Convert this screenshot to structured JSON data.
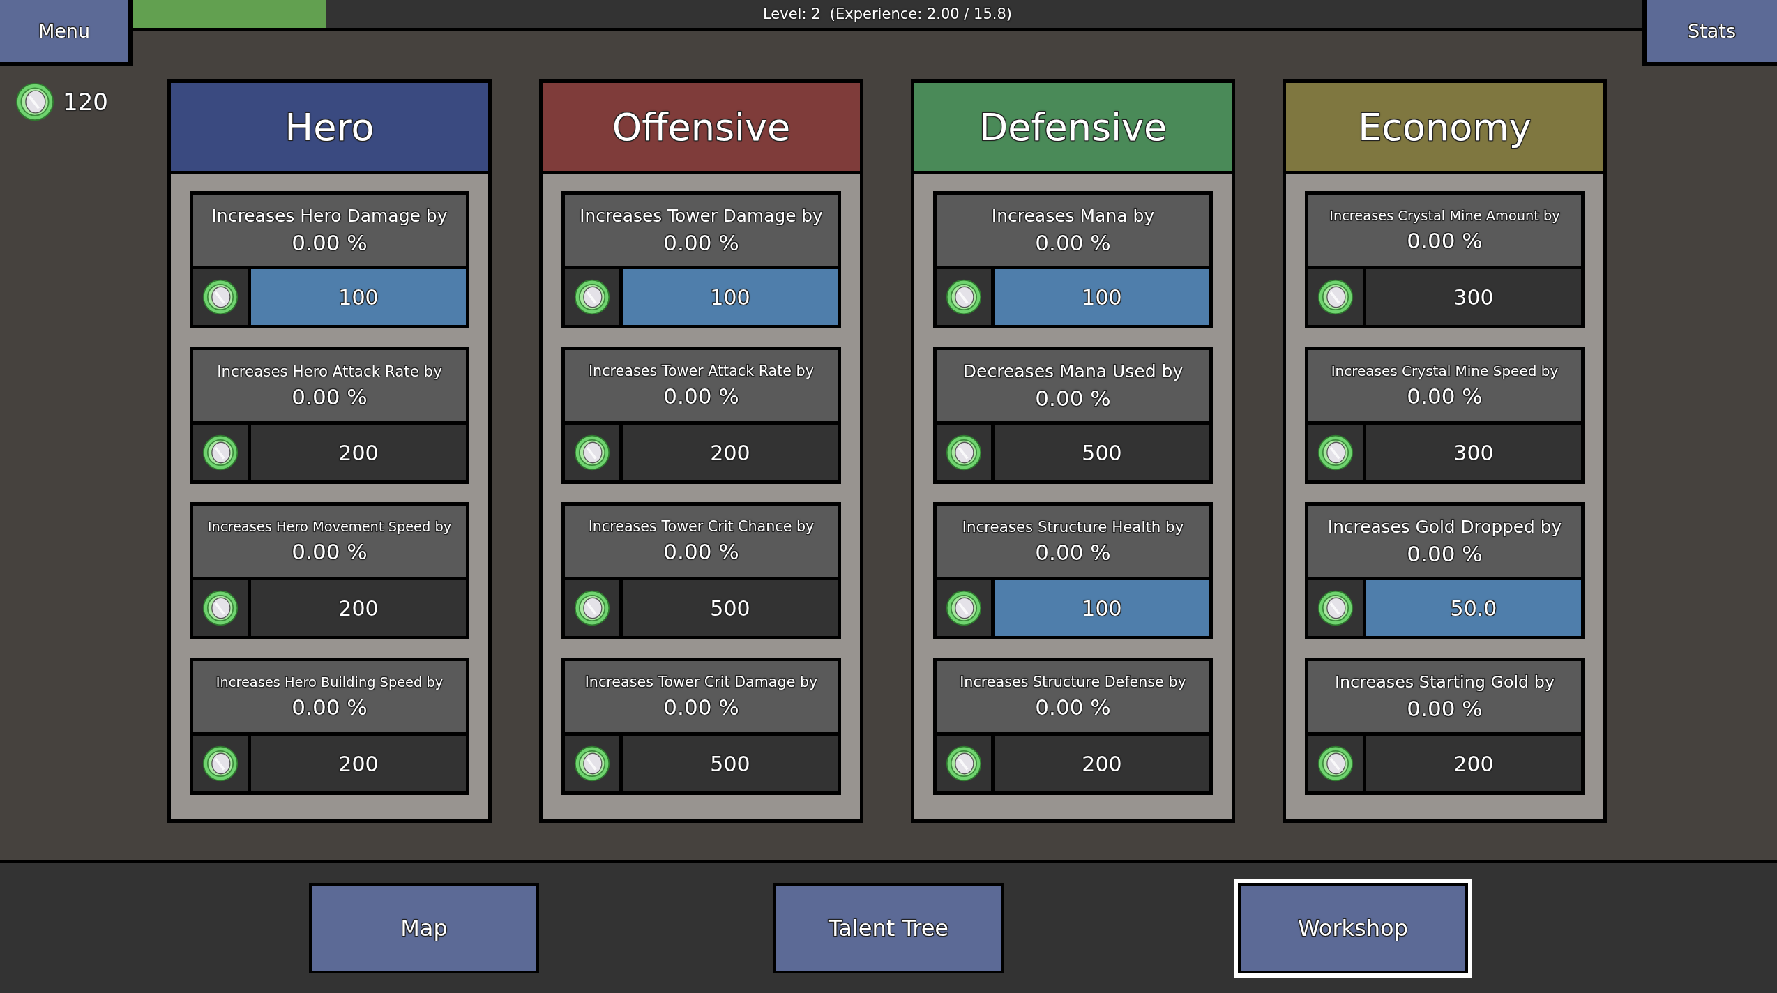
{
  "menu_button": "Menu",
  "experience_bar": {
    "label": "Level: 2  (Experience: 2.00 / 15.8)",
    "level": 0.128
  },
  "stats_button": "Stats",
  "currency": "120",
  "columns": [
    {
      "title": "Hero",
      "color": "#3a4a80",
      "upgrades": [
        {
          "label": "Increases Hero Damage by",
          "value": "0.00 %",
          "cost": "100",
          "affordable": true
        },
        {
          "label": "Increases Hero Attack Rate by",
          "value": "0.00 %",
          "cost": "200",
          "affordable": false
        },
        {
          "label": "Increases Hero Movement Speed by",
          "value": "0.00 %",
          "cost": "200",
          "affordable": false
        },
        {
          "label": "Increases Hero Building Speed by",
          "value": "0.00 %",
          "cost": "200",
          "affordable": false
        }
      ]
    },
    {
      "title": "Offensive",
      "color": "#7f3c3a",
      "upgrades": [
        {
          "label": "Increases Tower Damage by",
          "value": "0.00 %",
          "cost": "100",
          "affordable": true
        },
        {
          "label": "Increases Tower Attack Rate by",
          "value": "0.00 %",
          "cost": "200",
          "affordable": false
        },
        {
          "label": "Increases Tower Crit Chance by",
          "value": "0.00 %",
          "cost": "500",
          "affordable": false
        },
        {
          "label": "Increases Tower Crit Damage by",
          "value": "0.00 %",
          "cost": "500",
          "affordable": false
        }
      ]
    },
    {
      "title": "Defensive",
      "color": "#4a8a58",
      "upgrades": [
        {
          "label": "Increases Mana by",
          "value": "0.00 %",
          "cost": "100",
          "affordable": true
        },
        {
          "label": "Decreases Mana Used by",
          "value": "0.00 %",
          "cost": "500",
          "affordable": false
        },
        {
          "label": "Increases Structure Health by",
          "value": "0.00 %",
          "cost": "100",
          "affordable": true
        },
        {
          "label": "Increases Structure Defense by",
          "value": "0.00 %",
          "cost": "200",
          "affordable": false
        }
      ]
    },
    {
      "title": "Economy",
      "color": "#7f7740",
      "upgrades": [
        {
          "label": "Increases Crystal Mine Amount by",
          "value": "0.00 %",
          "cost": "300",
          "affordable": false
        },
        {
          "label": "Increases Crystal Mine Speed by",
          "value": "0.00 %",
          "cost": "300",
          "affordable": false
        },
        {
          "label": "Increases Gold Dropped by",
          "value": "0.00 %",
          "cost": "50.0",
          "affordable": true
        },
        {
          "label": "Increases Starting Gold by",
          "value": "0.00 %",
          "cost": "200",
          "affordable": false
        }
      ]
    }
  ],
  "nav_buttons": [
    {
      "label": "Map",
      "selected": false
    },
    {
      "label": "Talent Tree",
      "selected": false
    },
    {
      "label": "Workshop",
      "selected": true
    }
  ]
}
